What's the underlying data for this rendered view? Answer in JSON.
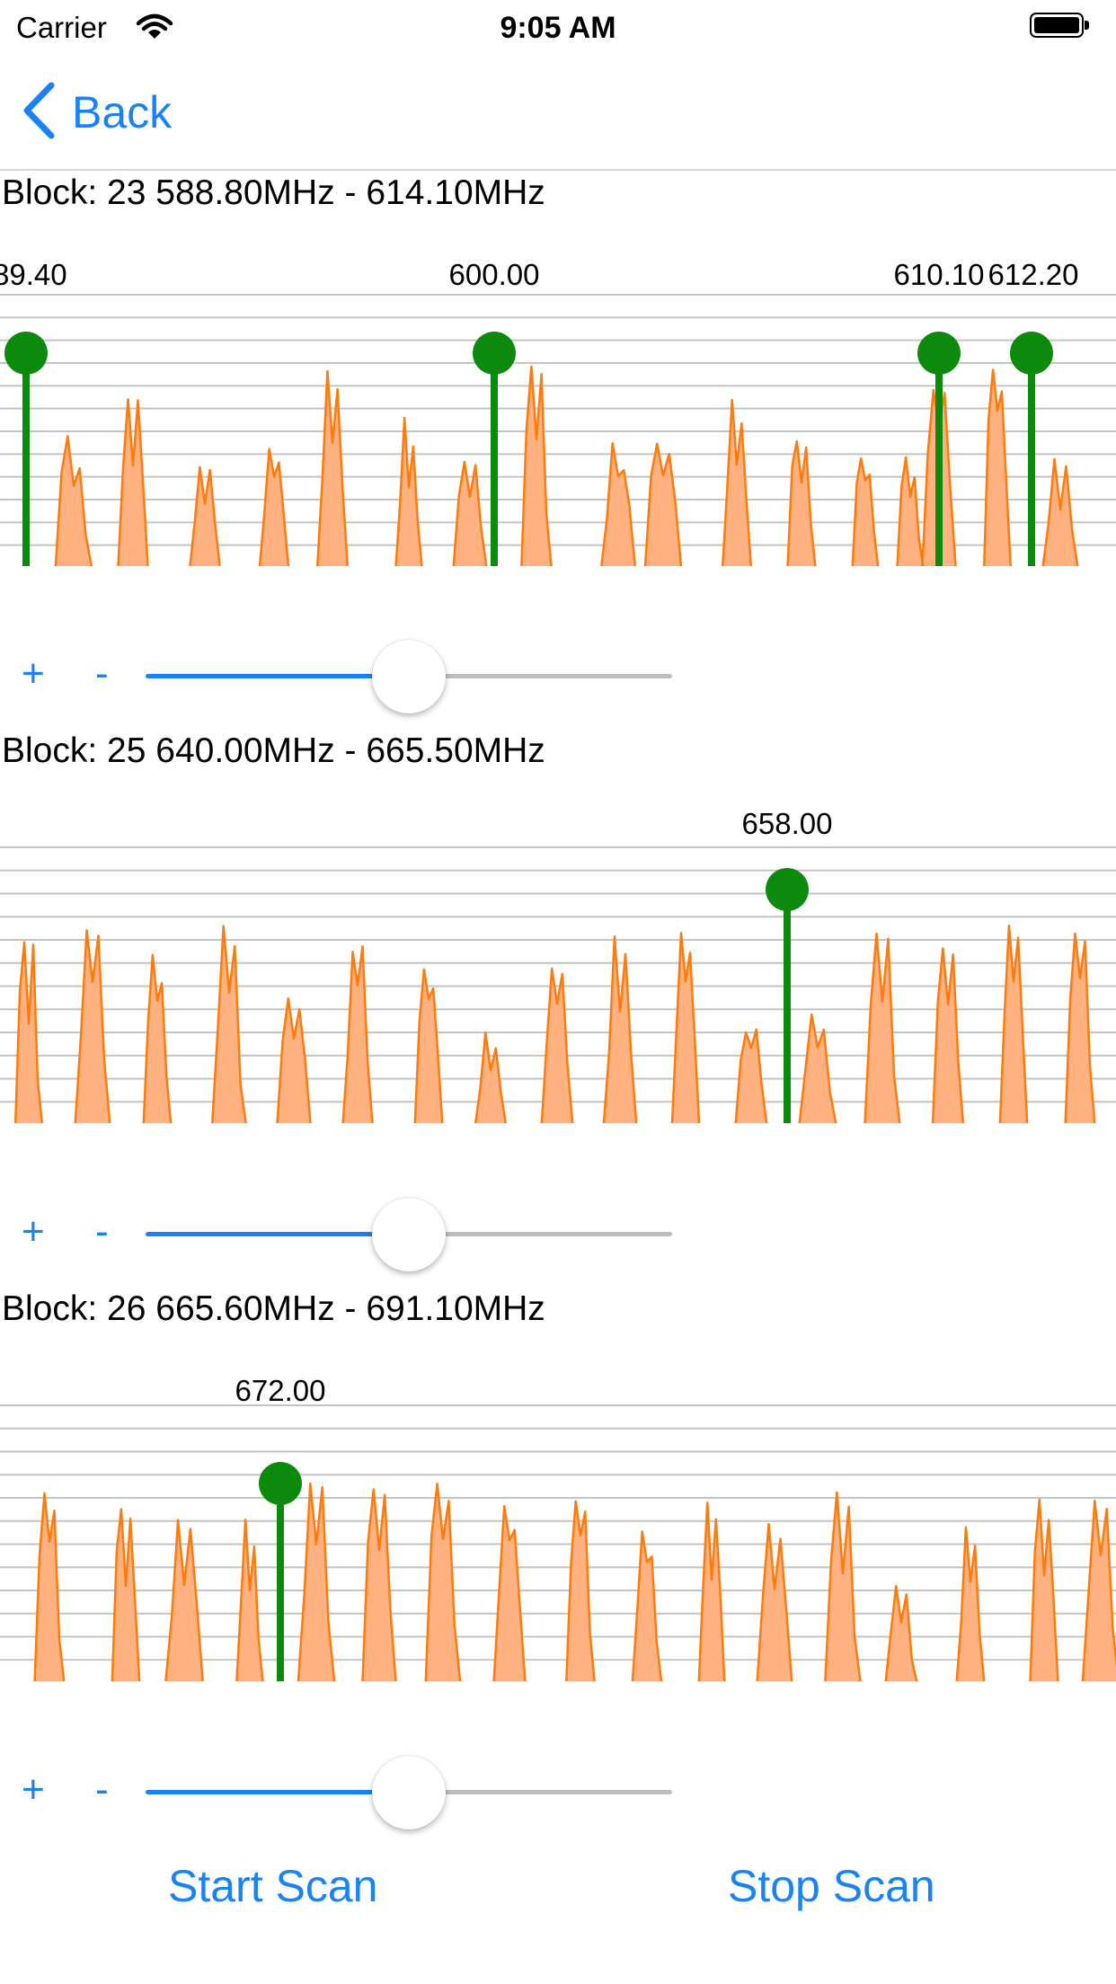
{
  "status_bar": {
    "carrier": "Carrier",
    "time": "9:05 AM"
  },
  "nav": {
    "back_label": "Back"
  },
  "colors": {
    "accent": "#1a82f7",
    "spectrum_fill": "#ffb27f",
    "spectrum_line": "#ff7a0c",
    "marker": "#0c8a0c",
    "grid": "#c4c4c4"
  },
  "blocks": [
    {
      "title": "Block: 23 588.80MHz - 614.10MHz",
      "start_mhz": 588.8,
      "end_mhz": 614.1,
      "markers": [
        {
          "label": "89.40"
        },
        {
          "label": "600.00"
        },
        {
          "label": "610.10"
        },
        {
          "label": "612.20"
        }
      ],
      "slider_value": 0.5,
      "plus_label": "+",
      "minus_label": "-"
    },
    {
      "title": "Block: 25 640.00MHz - 665.50MHz",
      "start_mhz": 640.0,
      "end_mhz": 665.5,
      "markers": [
        {
          "label": "658.00"
        }
      ],
      "slider_value": 0.5,
      "plus_label": "+",
      "minus_label": "-"
    },
    {
      "title": "Block: 26 665.60MHz - 691.10MHz",
      "start_mhz": 665.6,
      "end_mhz": 691.1,
      "markers": [
        {
          "label": "672.00"
        }
      ],
      "slider_value": 0.5,
      "plus_label": "+",
      "minus_label": "-"
    }
  ],
  "buttons": {
    "start_scan": "Start Scan",
    "stop_scan": "Stop Scan"
  }
}
